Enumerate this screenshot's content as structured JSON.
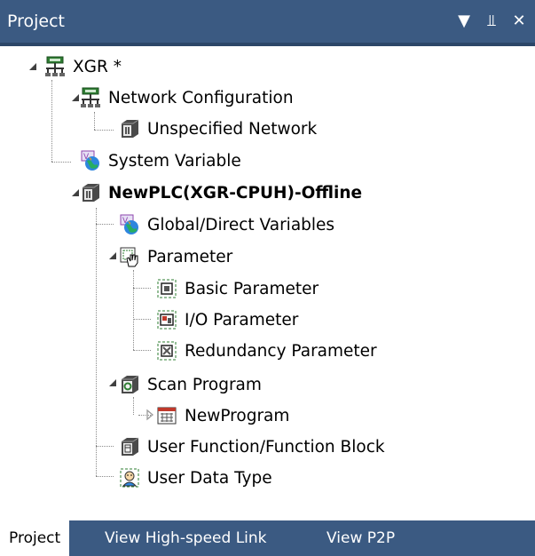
{
  "panel": {
    "title": "Project"
  },
  "tree": [
    {
      "label": "XGR *",
      "icon": "network-icon"
    },
    {
      "label": "Network Configuration",
      "icon": "network-icon"
    },
    {
      "label": "Unspecified Network",
      "icon": "plc-module-icon"
    },
    {
      "label": "System Variable",
      "icon": "globe-variable-icon"
    },
    {
      "label": "NewPLC(XGR-CPUH)-Offline",
      "icon": "plc-module-icon"
    },
    {
      "label": "Global/Direct Variables",
      "icon": "globe-variable-icon"
    },
    {
      "label": "Parameter",
      "icon": "hand-parameter-icon"
    },
    {
      "label": "Basic Parameter",
      "icon": "parameter-icon"
    },
    {
      "label": "I/O Parameter",
      "icon": "parameter-icon"
    },
    {
      "label": "Redundancy Parameter",
      "icon": "parameter-icon"
    },
    {
      "label": "Scan Program",
      "icon": "scan-program-icon"
    },
    {
      "label": "NewProgram",
      "icon": "ladder-program-icon"
    },
    {
      "label": "User Function/Function Block",
      "icon": "function-block-icon"
    },
    {
      "label": "User Data Type",
      "icon": "user-data-type-icon"
    }
  ],
  "tabs": [
    {
      "label": "Project",
      "active": true
    },
    {
      "label": "View High-speed Link",
      "active": false
    },
    {
      "label": "View P2P",
      "active": false
    }
  ]
}
